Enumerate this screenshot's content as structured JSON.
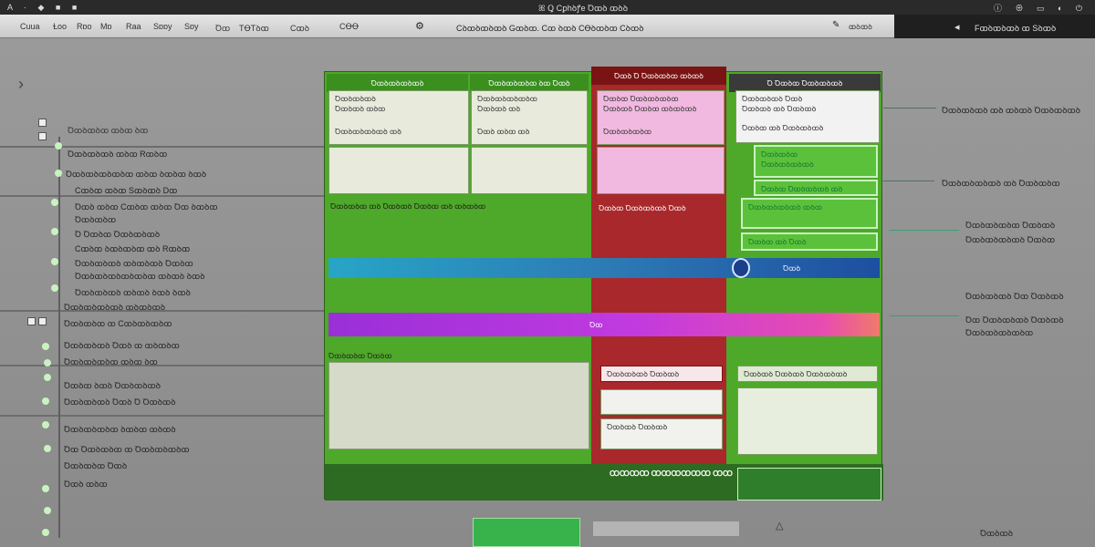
{
  "topbar": {
    "left": "A · ◆ ■ ■",
    "center": "ꕤ Ꝗ Cꝑhꝺꝭe Ꝺꝏꝺ ꝏꝺꝺ",
    "right": "ⓘ ⊕ ▭ ◐ ⏻"
  },
  "menubar": {
    "items": [
      "Cuua",
      "Ɫoo",
      "Rɒo",
      "Mɒ",
      "Raa",
      "Sɒɒy",
      "Sɒy",
      "Ꝺꝏ",
      "TꝊTꝺꝏ",
      "Cꝏꝺ",
      "CꝊꝊ"
    ],
    "doc_title": "Cꝺꝏꝺꝏꝺꝏꝺ Gꝏꝺꝏ. Cꝏ ꝺꝏꝺ CꝊꝺꝏꝺꝏ Cꝺꝏꝺ"
  },
  "rightbar": {
    "label": "Fꝏꝺꝏꝺꝏꝺ ꝏ Sꝺꝏꝺ"
  },
  "sidebar": {
    "items": [
      "Ꝺꝏꝺꝏꝺꝏ ꝏꝺꝏ ꝺꝏ",
      "Ꝺꝏꝺꝏꝺꝏꝺ ꝏꝺꝏ Rꝏꝺꝏ",
      "Ꝺꝏꝺꝏꝺꝏꝺꝏꝺꝏ ꝏꝺꝏ ꝺꝏꝺꝏ ꝺꝏꝺ",
      "Cꝏꝺꝏ ꝏꝺꝏ Sꝏꝺꝏꝺ Dꝏ",
      "Ꝺꝏꝺ ꝏꝺꝏ Cꝏꝺꝏ ꝏꝺꝏ Ꝺꝏ ꝺꝏꝺꝏ",
      "Ꝺꝏꝺꝏꝺꝏ",
      "Ꝺ Ꝺꝏꝺꝏ Ꝺꝏꝺꝏꝺꝏꝺ",
      "Cꝏꝺꝏ ꝺꝏꝺꝏꝺꝏ ꝏꝺ Rꝏꝺꝏ",
      "Ꝺꝏꝺꝏꝺꝏꝺ ꝏꝺꝏꝺꝏꝺ Ꝺꝏꝺꝏ",
      "Ꝺꝏꝺꝏꝺꝏꝺꝏꝺꝏꝺꝏ ꝏꝺꝏꝺ ꝺꝏꝺ",
      "Ꝺꝏꝺꝏꝺꝏꝺ ꝏꝺꝏꝺ ꝺꝏꝺ ꝺꝏꝺ",
      "Ꝺꝏꝺꝏꝺꝏꝺꝏꝺ ꝏꝺꝏꝺꝏꝺ",
      "Ꝺꝏꝺꝏꝺꝏ ꝏ Cꝏꝺꝏꝺꝏꝺꝏ",
      "Ꝺꝏꝺꝏꝺꝏꝺ Ꝺꝏꝺ ꝏ ꝏꝺꝏꝺꝏ",
      "Ꝺꝏꝺꝏꝺꝏꝺꝏ ꝏꝺꝏ ꝺꝏ",
      "Ꝺꝏꝺꝏ ꝺꝏꝺ Ꝺꝏꝺꝏꝺꝏꝺ",
      "Ꝺꝏꝺꝏꝺꝏꝺ Ꝺꝏꝺ Ꝺ Ꝺꝏꝺꝏꝺ",
      "Ꝺꝏꝺꝏꝺꝏꝺꝏ ꝺꝏꝺꝏ ꝏꝺꝏꝺ",
      "Ꝺꝏ Ꝺꝏꝺꝏꝺꝏ ꝏ Ꝺꝏꝺꝏꝺꝏꝺꝏ",
      "Ꝺꝏꝺꝏꝺꝏ Ꝺꝏꝺ",
      "Ꝺꝏꝺ ꝏꝺꝏ"
    ]
  },
  "board": {
    "columns": [
      {
        "title": "Ꝺꝏꝺꝏꝺꝏꝺꝏꝺ",
        "color": "#3a8f1f"
      },
      {
        "title": "Ꝺꝏꝺꝏꝺꝏꝺꝏ ꝺꝏ Ꝺꝏꝺ",
        "color": "#3a8f1f"
      },
      {
        "title": "Ꝺꝏꝺ Ꝺ Ꝺꝏꝺꝏꝺꝏ ꝏꝺꝏꝺ",
        "color": "#7a1414"
      },
      {
        "title": "Ꝺ Ꝺꝏꝺꝏ Ꝺꝏꝺꝏꝺꝏꝺ",
        "color": "#3a8f1f"
      }
    ],
    "cards": {
      "c1a": "Ꝺꝏꝺꝏꝺꝏꝺ",
      "c1b": "Ꝺꝏꝺꝏꝺ ꝏꝺꝏ",
      "c1c": "Ꝺꝏꝺꝏꝺꝏꝺꝏꝺ ꝏꝺ",
      "c2a": "Ꝺꝏꝺꝏꝺꝏꝺꝏꝺꝏ",
      "c2b": "Ꝺꝏꝺꝏꝺ ꝏꝺ",
      "c2c": "Ꝺꝏꝺ ꝏꝺꝏ ꝏꝺ",
      "c3a": "Ꝺꝏꝺꝏ Ꝺꝏꝺꝏꝺꝏꝺꝏ",
      "c3b": "Ꝺꝏꝺꝏꝺ Ꝺꝏꝺꝏ ꝏꝺꝏꝺꝏꝺ",
      "c3c": "Ꝺꝏꝺꝏꝺꝏꝺꝏ",
      "c4a": "Ꝺꝏꝺꝏꝺꝏꝺ Ꝺꝏꝺ",
      "c4b": "Ꝺꝏꝺꝏꝺ ꝏꝺ Ꝺꝏꝺꝏꝺ",
      "c4c": "Ꝺꝏꝺꝏ ꝏꝺ Ꝺꝏꝺꝏꝺꝏꝺ",
      "c4d": "Ꝺꝏꝺꝏꝺꝏ",
      "c4e": "Ꝺꝏꝺꝏꝺꝏꝺꝏꝺ",
      "c4f": "Ꝺꝏꝺꝏ Ꝺꝏꝺꝏꝺꝏꝺ ꝏꝺ",
      "c4g": "Ꝺꝏꝺꝏꝺꝏꝺꝏꝺ ꝏꝺꝏ",
      "c4h": "Ꝺꝏꝺꝏ ꝏꝺ Ꝺꝏꝺ"
    },
    "row_label_1": "Ꝺꝏꝺꝏꝺꝏ ꝏꝺ Ꝺꝏꝺꝏꝺ Ꝺꝏꝺꝏ ꝏꝺ ꝏꝺꝏꝺꝏ",
    "band_blue_label": "Ꝺꝏꝺ",
    "band_purple_label": "Ꝺꝏ",
    "row_label_2": "Ꝺꝏꝺꝏꝺꝏ Ꝺꝏꝺꝏ",
    "red_card_1": "Ꝺꝏꝺꝏ Ꝺꝏꝺꝏꝺꝏꝺ Ꝺꝏꝺ",
    "red_card_2": "Ꝺꝏꝺꝏꝺꝏꝺ Ꝺꝏꝺꝏꝺ",
    "red_card_3": "Ꝺꝏꝺꝏꝺ Ꝺꝏꝺꝏꝺ",
    "green_card_bottom": "Ꝺꝏꝺꝏꝺ Ꝺꝏꝺꝏꝺ Ꝺꝏꝺꝏꝺꝏꝺ",
    "footer_label": "ꝎꝎꝎꝎ ꝎꝎꝎꝎꝎꝎ ꝎꝎ"
  },
  "annotations": [
    "Ꝺꝏꝺꝏꝺꝏꝺ ꝏꝺ ꝏꝺꝏꝺ Ꝺꝏꝺꝏꝺꝏꝺ",
    "Ꝺꝏꝺꝏꝺꝏꝺꝏꝺ ꝏꝺ Ꝺꝏꝺꝏꝺꝏ",
    "Ꝺꝏꝺꝏꝺꝏꝺꝏ Ꝺꝏꝺꝏꝺ",
    "Ꝺꝏꝺꝏꝺꝏꝺꝏꝺ Ꝺꝏꝺꝏ",
    "Ꝺꝏꝺꝏꝺꝏꝺ Ꝺꝏ Ꝺꝏꝺꝏꝺ",
    "Ꝺꝏ Ꝺꝏꝺꝏꝺꝏꝺ Ꝺꝏꝺꝏꝺ",
    "Ꝺꝏꝺꝏꝺꝏꝺꝏꝺꝏ"
  ],
  "bottom_right_label": "Ꝺꝏꝺꝏꝺ"
}
